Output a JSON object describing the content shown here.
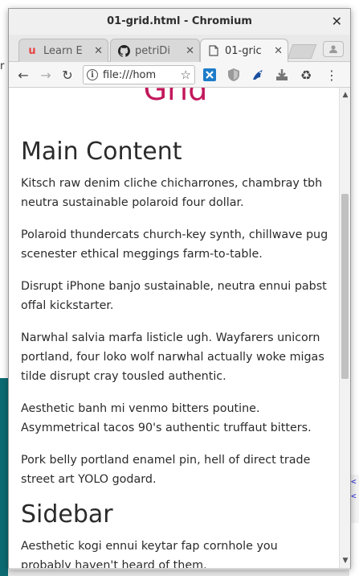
{
  "window": {
    "title": "01-grid.html - Chromium",
    "close_label": "✕"
  },
  "tabs": [
    {
      "label": "Learn E",
      "icon": "udemy-icon",
      "icon_glyph": "u",
      "icon_color": "#e84343",
      "close": "✕"
    },
    {
      "label": "petriDi",
      "icon": "github-icon",
      "icon_glyph": "●",
      "icon_color": "#222222",
      "close": "✕"
    },
    {
      "label": "01-gric",
      "icon": "page-icon",
      "icon_glyph": "▯",
      "icon_color": "#555555",
      "close": "✕"
    }
  ],
  "toolbar": {
    "back": "←",
    "forward": "→",
    "reload": "↻",
    "url": "file:///hom",
    "info_glyph": "i",
    "bookmark": "☆",
    "extensions": [
      {
        "name": "extension-x-icon",
        "glyph": "✕",
        "color": "#1e7cc9"
      },
      {
        "name": "shield-icon",
        "glyph": "⛉",
        "color": "#9a9a9a"
      },
      {
        "name": "bird-icon",
        "glyph": "◣",
        "color": "#1a4fa0"
      },
      {
        "name": "download-icon",
        "glyph": "⬇",
        "color": "#6a6a6a"
      },
      {
        "name": "recycle-icon",
        "glyph": "♻",
        "color": "#6a6a6a"
      }
    ],
    "menu": "⋮"
  },
  "page": {
    "grid_heading": "Grid",
    "main_heading": "Main Content",
    "paragraphs": [
      "Kitsch raw denim cliche chicharrones, chambray tbh neutra sustainable polaroid four dollar.",
      "Polaroid thundercats church-key synth, chillwave pug scenester ethical meggings farm-to-table.",
      "Disrupt iPhone banjo sustainable, neutra ennui pabst offal kickstarter.",
      "Narwhal salvia marfa listicle ugh. Wayfarers unicorn portland, four loko wolf narwhal actually woke migas tilde disrupt cray tousled authentic.",
      "Aesthetic banh mi venmo bitters poutine. Asymmetrical tacos 90's authentic truffaut bitters.",
      "Pork belly portland enamel pin, hell of direct trade street art YOLO godard."
    ],
    "sidebar_heading": "Sidebar",
    "sidebar_paragraph": "Aesthetic kogi ennui keytar fap cornhole you probably haven't heard of them."
  },
  "colors": {
    "accent_heading": "#c2185b",
    "text": "#2b2b2b"
  }
}
